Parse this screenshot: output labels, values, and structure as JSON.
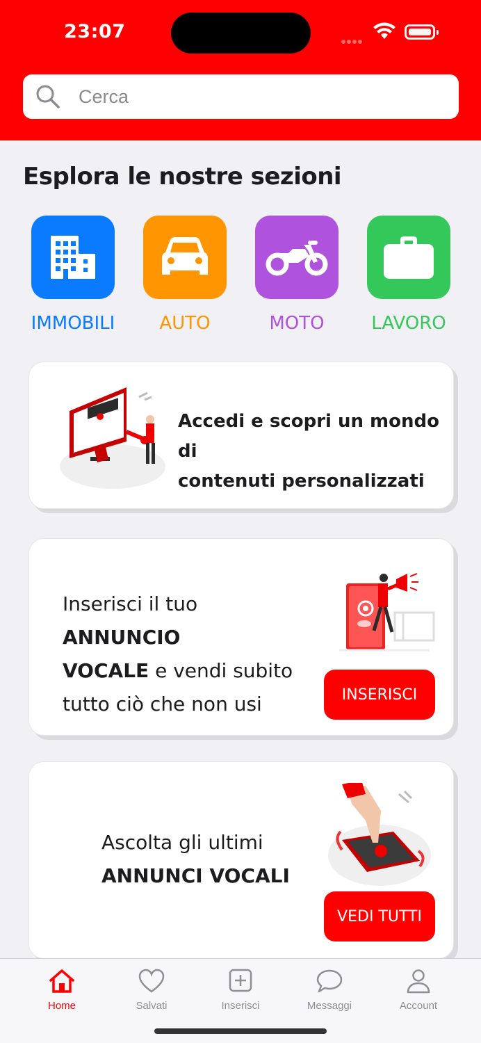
{
  "status_bar": {
    "time": "23:07"
  },
  "search": {
    "placeholder": "Cerca"
  },
  "section_title": "Esplora le nostre sezioni",
  "categories": [
    {
      "label": "IMMOBILI",
      "color": "#0a7aff",
      "icon": "building-icon"
    },
    {
      "label": "AUTO",
      "color": "#ff9500",
      "icon": "car-icon"
    },
    {
      "label": "MOTO",
      "color": "#af52de",
      "icon": "motorcycle-icon"
    },
    {
      "label": "LAVORO",
      "color": "#34c759",
      "icon": "briefcase-icon"
    }
  ],
  "cards": {
    "login": {
      "line1": "Accedi e scopri un mondo di",
      "line2": "contenuti personalizzati"
    },
    "voice_ad": {
      "p1": "Inserisci il tuo ",
      "b1": "ANNUNCIO",
      "b2": "VOCALE",
      "p2": " e vendi subito",
      "p3": "tutto ciò che non usi",
      "button": "INSERISCI"
    },
    "listen": {
      "line1": "Ascolta gli ultimi",
      "line2": "ANNUNCI VOCALI",
      "button": "VEDI TUTTI"
    }
  },
  "tabbar": [
    {
      "label": "Home",
      "icon": "home-icon",
      "active": true
    },
    {
      "label": "Salvati",
      "icon": "heart-icon"
    },
    {
      "label": "Inserisci",
      "icon": "plus-square-icon"
    },
    {
      "label": "Messaggi",
      "icon": "chat-bubble-icon"
    },
    {
      "label": "Account",
      "icon": "person-icon"
    }
  ],
  "colors": {
    "brand": "#ff0000",
    "background": "#f1f1f5"
  }
}
